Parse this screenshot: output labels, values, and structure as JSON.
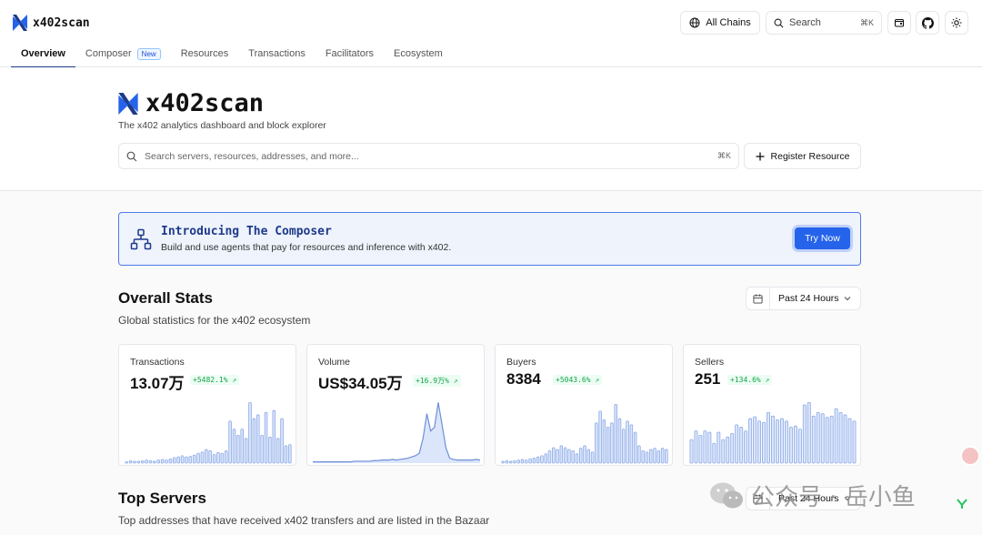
{
  "header": {
    "brand": "x402scan",
    "chains_label": "All Chains",
    "search_label": "Search",
    "search_kbd": "⌘K"
  },
  "tabs": [
    {
      "label": "Overview"
    },
    {
      "label": "Composer",
      "badge": "New"
    },
    {
      "label": "Resources"
    },
    {
      "label": "Transactions"
    },
    {
      "label": "Facilitators"
    },
    {
      "label": "Ecosystem"
    }
  ],
  "hero": {
    "title": "x402scan",
    "subtitle": "The x402 analytics dashboard and block explorer",
    "search_placeholder": "Search servers, resources, addresses, and more...",
    "search_kbd": "⌘K",
    "register_label": "Register Resource"
  },
  "promo": {
    "title": "Introducing The Composer",
    "description": "Build and use agents that pay for resources and inference with x402.",
    "button": "Try Now"
  },
  "overall": {
    "title": "Overall Stats",
    "subtitle": "Global statistics for the x402 ecosystem",
    "period": "Past 24 Hours"
  },
  "stats": [
    {
      "label": "Transactions",
      "value": "13.07万",
      "change": "+5482.1%",
      "bars": [
        0.02,
        0.04,
        0.03,
        0.03,
        0.04,
        0.05,
        0.04,
        0.03,
        0.05,
        0.06,
        0.05,
        0.07,
        0.09,
        0.1,
        0.12,
        0.1,
        0.11,
        0.13,
        0.16,
        0.18,
        0.22,
        0.2,
        0.14,
        0.17,
        0.16,
        0.2,
        0.68,
        0.55,
        0.45,
        0.55,
        0.4,
        0.98,
        0.72,
        0.78,
        0.45,
        0.82,
        0.42,
        0.85,
        0.4,
        0.72,
        0.28,
        0.3
      ]
    },
    {
      "label": "Volume",
      "value": "US$34.05万",
      "change": "+16.9万%",
      "line": [
        0.02,
        0.02,
        0.02,
        0.02,
        0.02,
        0.02,
        0.02,
        0.02,
        0.02,
        0.02,
        0.02,
        0.03,
        0.03,
        0.03,
        0.03,
        0.03,
        0.04,
        0.04,
        0.05,
        0.05,
        0.05,
        0.06,
        0.05,
        0.06,
        0.07,
        0.08,
        0.1,
        0.12,
        0.16,
        0.4,
        0.8,
        0.52,
        0.58,
        0.98,
        0.62,
        0.25,
        0.08,
        0.06,
        0.05,
        0.05,
        0.05,
        0.05,
        0.05,
        0.06,
        0.05
      ]
    },
    {
      "label": "Buyers",
      "value": "8384",
      "change": "+5043.6%",
      "bars": [
        0.03,
        0.04,
        0.03,
        0.04,
        0.05,
        0.06,
        0.05,
        0.07,
        0.08,
        0.1,
        0.12,
        0.15,
        0.2,
        0.25,
        0.22,
        0.28,
        0.25,
        0.22,
        0.2,
        0.15,
        0.24,
        0.28,
        0.22,
        0.18,
        0.65,
        0.84,
        0.7,
        0.58,
        0.65,
        0.95,
        0.72,
        0.55,
        0.68,
        0.62,
        0.5,
        0.28,
        0.2,
        0.18,
        0.22,
        0.24,
        0.2,
        0.24,
        0.22
      ]
    },
    {
      "label": "Sellers",
      "value": "251",
      "change": "+134.6%",
      "bars": [
        0.38,
        0.52,
        0.45,
        0.52,
        0.5,
        0.32,
        0.5,
        0.38,
        0.42,
        0.48,
        0.62,
        0.58,
        0.52,
        0.72,
        0.75,
        0.68,
        0.66,
        0.82,
        0.76,
        0.7,
        0.72,
        0.68,
        0.58,
        0.6,
        0.55,
        0.94,
        0.98,
        0.76,
        0.82,
        0.8,
        0.74,
        0.76,
        0.88,
        0.82,
        0.78,
        0.72,
        0.68
      ]
    }
  ],
  "top_servers": {
    "title": "Top Servers",
    "subtitle": "Top addresses that have received x402 transfers and are listed in the Bazaar",
    "period": "Past 24 Hours"
  },
  "watermark": {
    "text": "公众号 · 岳小鱼"
  },
  "colors": {
    "accent": "#2563eb",
    "brand": "#1e3a8a",
    "positive": "#16a34a",
    "bar_fill": "#dbe6fa",
    "bar_stroke": "#8aa7e6"
  }
}
